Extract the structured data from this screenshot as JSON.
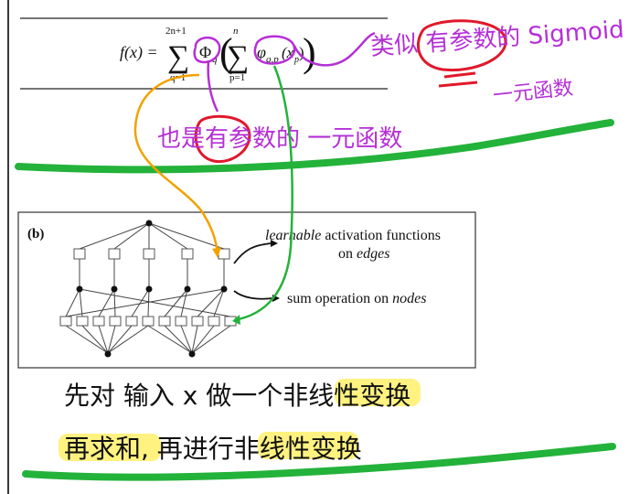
{
  "formula": {
    "lhs": "f(x) =",
    "outer_sum_upper": "2n+1",
    "outer_sum_lower": "q=1",
    "outer_fn": "Φ",
    "outer_fn_sub": "q",
    "inner_sum_upper": "n",
    "inner_sum_lower": "p=1",
    "inner_fn": "φ",
    "inner_fn_sub": "q,p",
    "inner_arg": "(x",
    "inner_arg_sub": "p",
    "inner_arg_close": ")"
  },
  "diagram": {
    "panel_label": "(b)",
    "line1_italic": "learnable",
    "line1_rest": " activation functions",
    "line2_prefix": "on ",
    "line2_italic": "edges",
    "line3_prefix": "sum operation on ",
    "line3_italic": "nodes"
  },
  "annotations": {
    "purple_note_1": "类似 有参数的 Sigmoid",
    "purple_note_2": "一元函数",
    "purple_note_3": "也是有参数的 一元函数",
    "note_line_1": "先对 输入 x 做一个非线性变换",
    "note_line_2": "再求和, 再进行非线性变换"
  },
  "colors": {
    "purple": "#b52fd6",
    "red": "#e0182a",
    "orange": "#f2a200",
    "green": "#23b23a",
    "highlight": "#fff06a"
  }
}
